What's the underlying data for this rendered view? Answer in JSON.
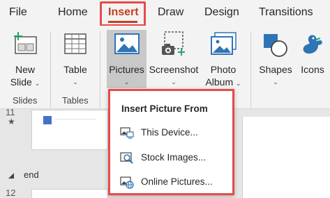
{
  "tabs": [
    {
      "label": "File"
    },
    {
      "label": "Home"
    },
    {
      "label": "Insert"
    },
    {
      "label": "Draw"
    },
    {
      "label": "Design"
    },
    {
      "label": "Transitions"
    }
  ],
  "ribbon": {
    "new_slide": {
      "line1": "New",
      "line2": "Slide",
      "chevron": "⌄"
    },
    "table": {
      "label": "Table",
      "chevron": "⌄"
    },
    "pictures": {
      "label": "Pictures",
      "chevron": "⌄"
    },
    "screenshot": {
      "label": "Screenshot",
      "chevron": "⌄"
    },
    "photo_album": {
      "line1": "Photo",
      "line2": "Album",
      "chevron": "⌄"
    },
    "shapes": {
      "label": "Shapes",
      "chevron": "⌄"
    },
    "icons": {
      "label": "Icons"
    },
    "groups": {
      "slides": "Slides",
      "tables": "Tables"
    }
  },
  "slide_pane": {
    "slide_11_number": "11",
    "slide_11_marker": "★",
    "section_name": "end",
    "slide_12_number": "12"
  },
  "insert_picture_menu": {
    "title": "Insert Picture From",
    "items": [
      {
        "label": "This Device...",
        "icon": "device-picture-icon"
      },
      {
        "label": "Stock Images...",
        "icon": "stock-images-icon"
      },
      {
        "label": "Online Pictures...",
        "icon": "online-pictures-icon"
      }
    ]
  },
  "colors": {
    "accent": "#c43e1c",
    "highlight_border": "#e84a4a",
    "icon_blue": "#4472c4",
    "icon_green": "#21a366"
  }
}
